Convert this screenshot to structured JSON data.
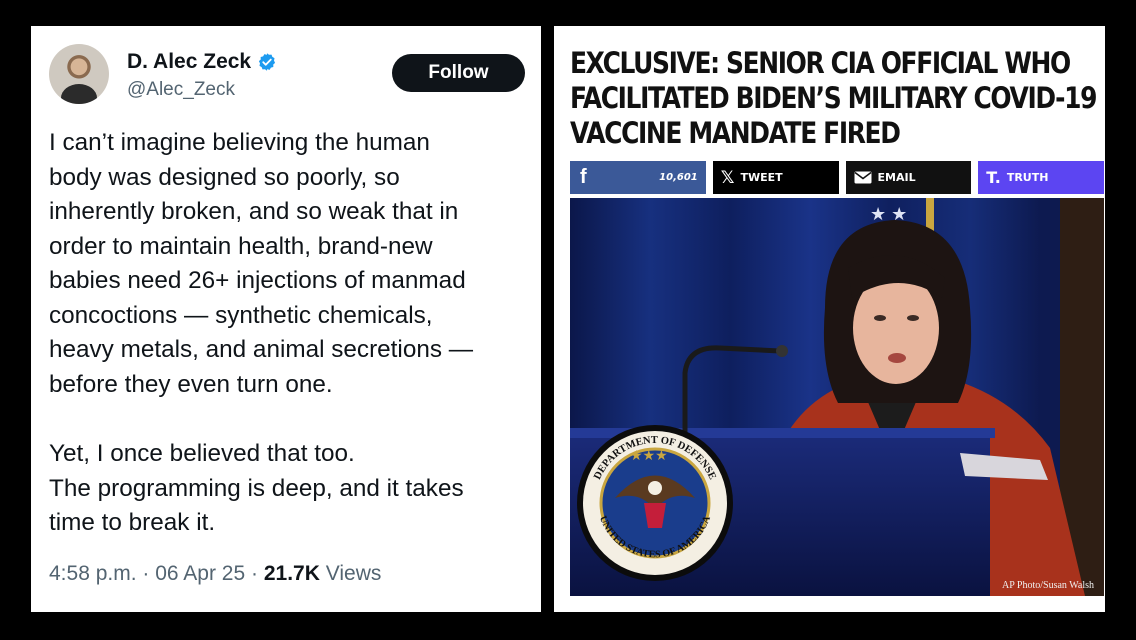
{
  "tweet": {
    "author_name": "D. Alec Zeck",
    "handle": "@Alec_Zeck",
    "follow_label": "Follow",
    "lines_para1": [
      "I can’t imagine believing the human",
      "body was designed so poorly, so",
      "inherently broken, and so weak that in",
      "order to maintain health, brand-new",
      "babies need 26+ injections of manmad",
      "concoctions — synthetic chemicals,",
      "heavy metals, and animal secretions —",
      "before they even turn one."
    ],
    "lines_para2": [
      "Yet, I once believed that too.",
      "The programming is deep, and it takes",
      "time to break it."
    ],
    "time": "4:58 p.m.",
    "separator": "·",
    "date": "06 Apr 25",
    "views_count": "21.7K",
    "views_label": "Views",
    "verified_color": "#1d9bf0"
  },
  "article": {
    "headline_lines": [
      "EXCLUSIVE: SENIOR CIA OFFICIAL WHO",
      "FACILITATED BIDEN’S MILITARY COVID-19",
      "VACCINE MANDATE FIRED"
    ],
    "share": {
      "facebook_icon": "f",
      "facebook_count": "10,601",
      "tweet_label": "TWEET",
      "email_label": "EMAIL",
      "truth_label": "TRUTH"
    },
    "seal_text_top": "DEPARTMENT OF DEFENSE",
    "seal_text_bottom": "UNITED STATES OF AMERICA",
    "photo_credit": "AP Photo/Susan Walsh",
    "colors": {
      "facebook": "#3b5998",
      "truth": "#5c45f2",
      "curtain": "#13246a"
    }
  }
}
